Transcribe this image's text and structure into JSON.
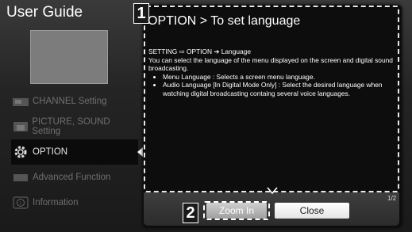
{
  "app": {
    "title": "User Guide"
  },
  "sidebar": {
    "items": [
      {
        "label": "CHANNEL Setting",
        "icon": "channel-icon"
      },
      {
        "label": "PICTURE, SOUND Setting",
        "icon": "picture-sound-icon"
      },
      {
        "label": "OPTION",
        "icon": "gear-icon",
        "active": true
      },
      {
        "label": "Advanced Function",
        "icon": "advanced-icon"
      },
      {
        "label": "Information",
        "icon": "info-icon"
      }
    ]
  },
  "dialog": {
    "badge_1": "1",
    "badge_2": "2",
    "title": "OPTION > To set language",
    "path": "SETTING ⇨ OPTION ➔ Language",
    "intro": "You can select the language of the menu displayed on the screen and digital sound broadcasting.",
    "bullets": [
      "Menu Language : Selects a screen menu language.",
      "Audio Language [In Digital Mode Only] : Select the desired language when watching digital broadcasting containg several voice languages."
    ],
    "page_indicator": "1/2",
    "zoom_label": "Zoom In",
    "close_label": "Close"
  },
  "colors": {
    "accent_bg": "#0d0d0d",
    "active_item": "#0b0b0b"
  }
}
